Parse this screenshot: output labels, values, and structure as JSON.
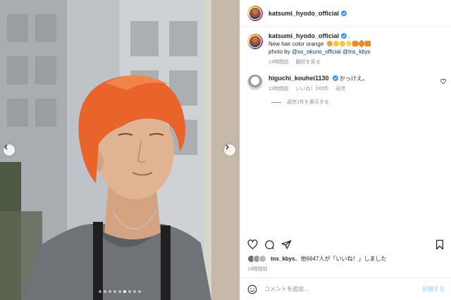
{
  "post": {
    "author": "katsumi_hyodo_official",
    "caption_text": "New hair color orange",
    "caption_suffix": ".",
    "photo_by_label": "photo by",
    "photo_credit_1": "@so_okuno_official",
    "photo_credit_2": "@tns_kbys",
    "caption_time": "14時間前",
    "translate_label": "翻訳を見る"
  },
  "comments": [
    {
      "username": "higuchi_kouhei1130",
      "text": "かっけえ。",
      "time": "13時間前",
      "likes": "いいね！242件",
      "reply_label": "返信",
      "view_replies": "返信2件を表示する"
    }
  ],
  "likes_summary": {
    "user": "tns_kbys",
    "rest": "、他6647人が「いいね！」しました",
    "posted_time": "14時間前"
  },
  "composer": {
    "placeholder": "コメントを追加...",
    "post_label": "投稿する"
  },
  "carousel": {
    "total": 9,
    "active": 6
  },
  "colors": {
    "verified": "#3897f0",
    "link": "#00376b",
    "hair": "#e9642b",
    "post_button": "#b2dffc"
  },
  "icons": [
    "chevron-left-icon",
    "chevron-right-icon",
    "verified-badge-icon",
    "heart-icon",
    "comment-icon",
    "share-icon",
    "bookmark-icon",
    "emoji-icon"
  ]
}
